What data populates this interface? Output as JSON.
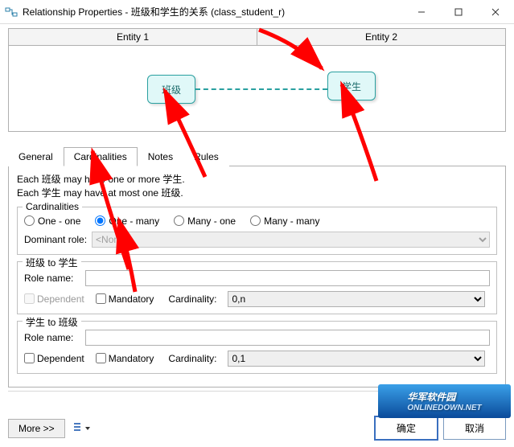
{
  "window": {
    "title": "Relationship Properties - 班级和学生的关系 (class_student_r)"
  },
  "entities_header": {
    "col1": "Entity 1",
    "col2": "Entity 2"
  },
  "diagram": {
    "entity1_label": "班级",
    "entity2_label": "学生"
  },
  "tabs": {
    "general": "General",
    "cardinalities": "Cardinalities",
    "notes": "Notes",
    "rules": "Rules"
  },
  "description": {
    "line1": "Each 班级 may have one or more 学生.",
    "line2": "Each 学生 may have at most one 班级."
  },
  "cardinalities_group": {
    "title": "Cardinalities",
    "one_one": "One - one",
    "one_many": "One - many",
    "many_one": "Many - one",
    "many_many": "Many - many",
    "dominant_label": "Dominant role:",
    "dominant_value": "<None>"
  },
  "rel1": {
    "title": "班级 to 学生",
    "rolename_label": "Role name:",
    "rolename_value": "",
    "dependent": "Dependent",
    "mandatory": "Mandatory",
    "cardinality_label": "Cardinality:",
    "cardinality_value": "0,n"
  },
  "rel2": {
    "title": "学生 to 班级",
    "rolename_label": "Role name:",
    "rolename_value": "",
    "dependent": "Dependent",
    "mandatory": "Mandatory",
    "cardinality_label": "Cardinality:",
    "cardinality_value": "0,1"
  },
  "buttons": {
    "more": "More >>",
    "ok": "确定",
    "cancel": "取消"
  },
  "watermark": {
    "top": "华军软件园",
    "bottom": "ONLINEDOWN.NET"
  }
}
